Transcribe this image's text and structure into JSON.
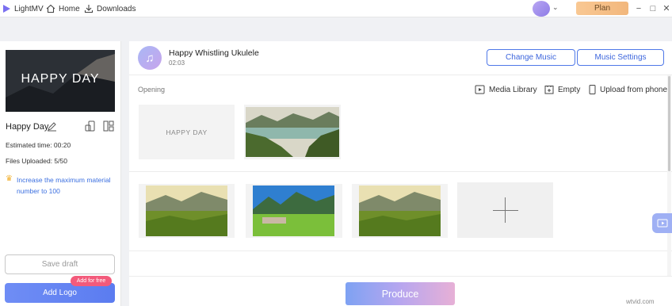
{
  "titlebar": {
    "app_name": "LightMV",
    "home": "Home",
    "downloads": "Downloads",
    "plan": "Plan",
    "minimize": "−",
    "maximize": "□",
    "close": "✕"
  },
  "project": {
    "thumbnail_text": "HAPPY DAY",
    "title": "Happy Day",
    "estimated_time": "Estimated time: 00:20",
    "files_uploaded": "Files Uploaded: 5/50",
    "upgrade_text": "Increase the maximum material number to 100",
    "save_draft": "Save draft",
    "add_logo": "Add Logo",
    "add_for_free": "Add for free"
  },
  "music": {
    "title": "Happy Whistling Ukulele",
    "duration": "02:03",
    "change_music": "Change Music",
    "music_settings": "Music Settings"
  },
  "editor": {
    "opening_label": "Opening",
    "media_library": "Media Library",
    "empty": "Empty",
    "upload_from_phone": "Upload from phone",
    "title_card_text": "HAPPY DAY"
  },
  "footer": {
    "produce": "Produce",
    "watermark": "wtvid.com"
  },
  "colors": {
    "accent": "#4f78e8",
    "plan": "#f2b77c",
    "badge": "#f35a7b"
  }
}
